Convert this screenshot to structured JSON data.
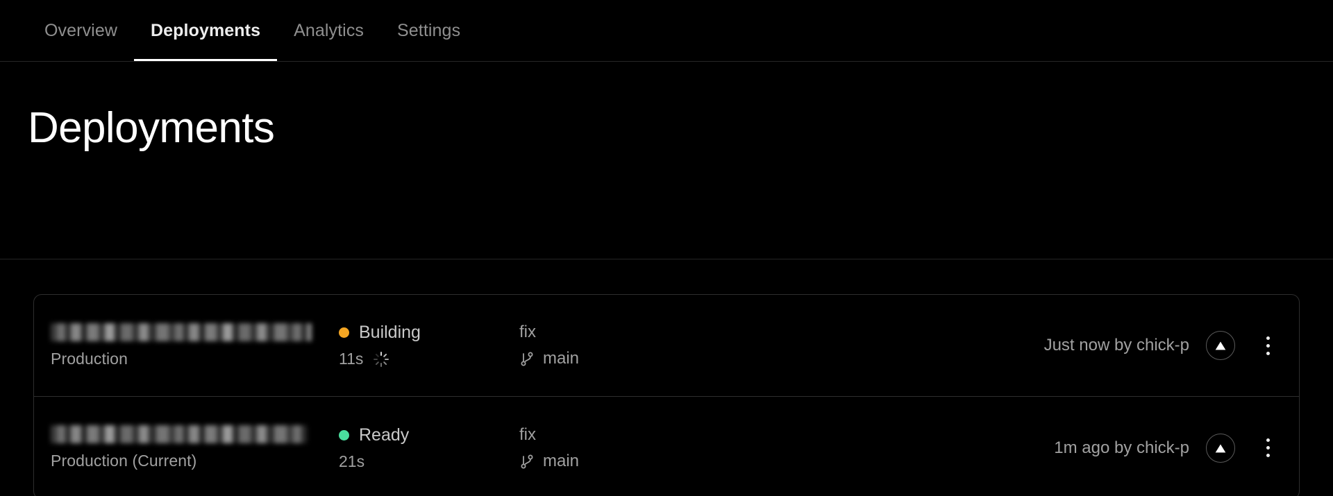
{
  "tabs": [
    {
      "label": "Overview",
      "active": false
    },
    {
      "label": "Deployments",
      "active": true
    },
    {
      "label": "Analytics",
      "active": false
    },
    {
      "label": "Settings",
      "active": false
    }
  ],
  "page": {
    "title": "Deployments"
  },
  "colors": {
    "background": "#000000",
    "border": "#2e2e2e",
    "text_primary": "#ededed",
    "text_secondary": "#a1a1a1",
    "status_building": "#f5a623",
    "status_ready": "#4ade9e",
    "tab_active_underline": "#ffffff"
  },
  "deployments": [
    {
      "name_redacted": true,
      "environment": "Production",
      "status": "Building",
      "status_color": "#f5a623",
      "duration": "11s",
      "has_spinner": true,
      "commit_message": "fix",
      "branch": "main",
      "branch_icon": "git-branch-icon",
      "meta": "Just now by chick-p",
      "avatar_icon": "vercel-triangle-avatar",
      "menu_icon": "kebab-menu-icon"
    },
    {
      "name_redacted": true,
      "environment": "Production (Current)",
      "status": "Ready",
      "status_color": "#4ade9e",
      "duration": "21s",
      "has_spinner": false,
      "commit_message": "fix",
      "branch": "main",
      "branch_icon": "git-branch-icon",
      "meta": "1m ago by chick-p",
      "avatar_icon": "vercel-triangle-avatar",
      "menu_icon": "kebab-menu-icon"
    }
  ]
}
